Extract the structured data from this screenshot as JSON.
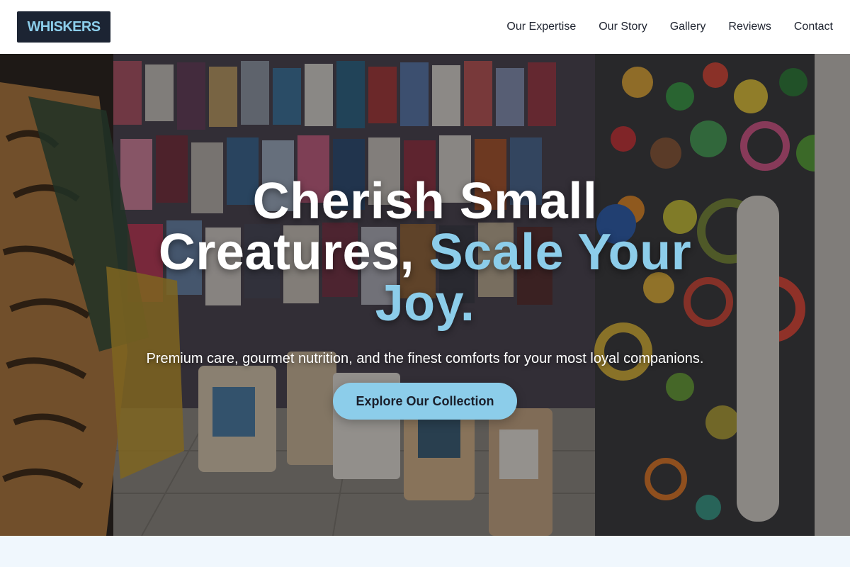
{
  "brand": {
    "name": "WHISKERS"
  },
  "nav": {
    "items": [
      {
        "label": "Our Expertise"
      },
      {
        "label": "Our Story"
      },
      {
        "label": "Gallery"
      },
      {
        "label": "Reviews"
      },
      {
        "label": "Contact"
      }
    ]
  },
  "hero": {
    "title_line1": "Cherish Small",
    "title_line2_a": "Creatures, ",
    "title_line2_b": "Scale Your",
    "title_line3": "Joy.",
    "subtitle": "Premium care, gourmet nutrition, and the finest comforts for your most loyal companions.",
    "cta_label": "Explore Our Collection",
    "background_description": "pet-shop-interior-photo"
  },
  "colors": {
    "accent": "#8ccdea",
    "logo_bg": "#1c2433",
    "nav_text": "#1f2430",
    "page_bg": "#f0f7fd"
  }
}
